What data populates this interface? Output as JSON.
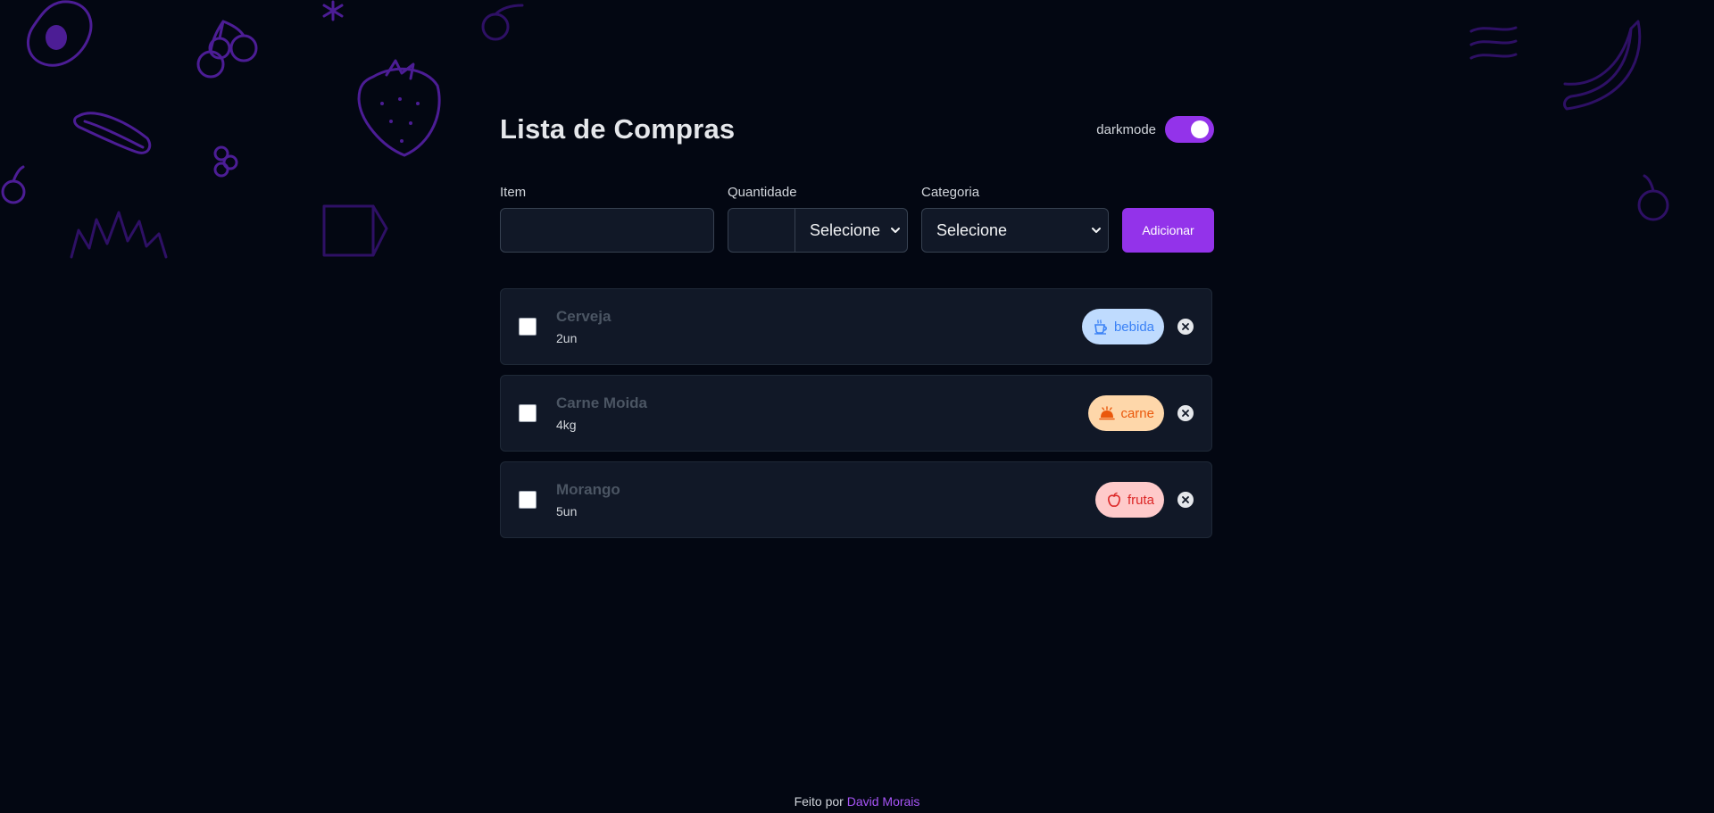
{
  "header": {
    "title": "Lista de Compras",
    "darkmode_label": "darkmode",
    "darkmode_on": true
  },
  "form": {
    "item_label": "Item",
    "item_value": "",
    "quantity_label": "Quantidade",
    "quantity_value": "",
    "unit_select_value": "Selecione",
    "category_label": "Categoria",
    "category_select_value": "Selecione",
    "add_button_label": "Adicionar"
  },
  "items": [
    {
      "name": "Cerveja",
      "quantity": "2un",
      "category": "bebida",
      "category_icon": "coffee-cup-icon",
      "checked": false
    },
    {
      "name": "Carne Moida",
      "quantity": "4kg",
      "category": "carne",
      "category_icon": "cloche-icon",
      "checked": false
    },
    {
      "name": "Morango",
      "quantity": "5un",
      "category": "fruta",
      "category_icon": "apple-icon",
      "checked": false
    }
  ],
  "colors": {
    "background": "#030712",
    "accent": "#9333ea",
    "bebida_bg": "#bfdbfe",
    "bebida_fg": "#3b82f6",
    "carne_bg": "#fed7aa",
    "carne_fg": "#ea580c",
    "fruta_bg": "#fecaca",
    "fruta_fg": "#dc2626"
  },
  "footer": {
    "prefix": "Feito por",
    "author": "David Morais"
  }
}
